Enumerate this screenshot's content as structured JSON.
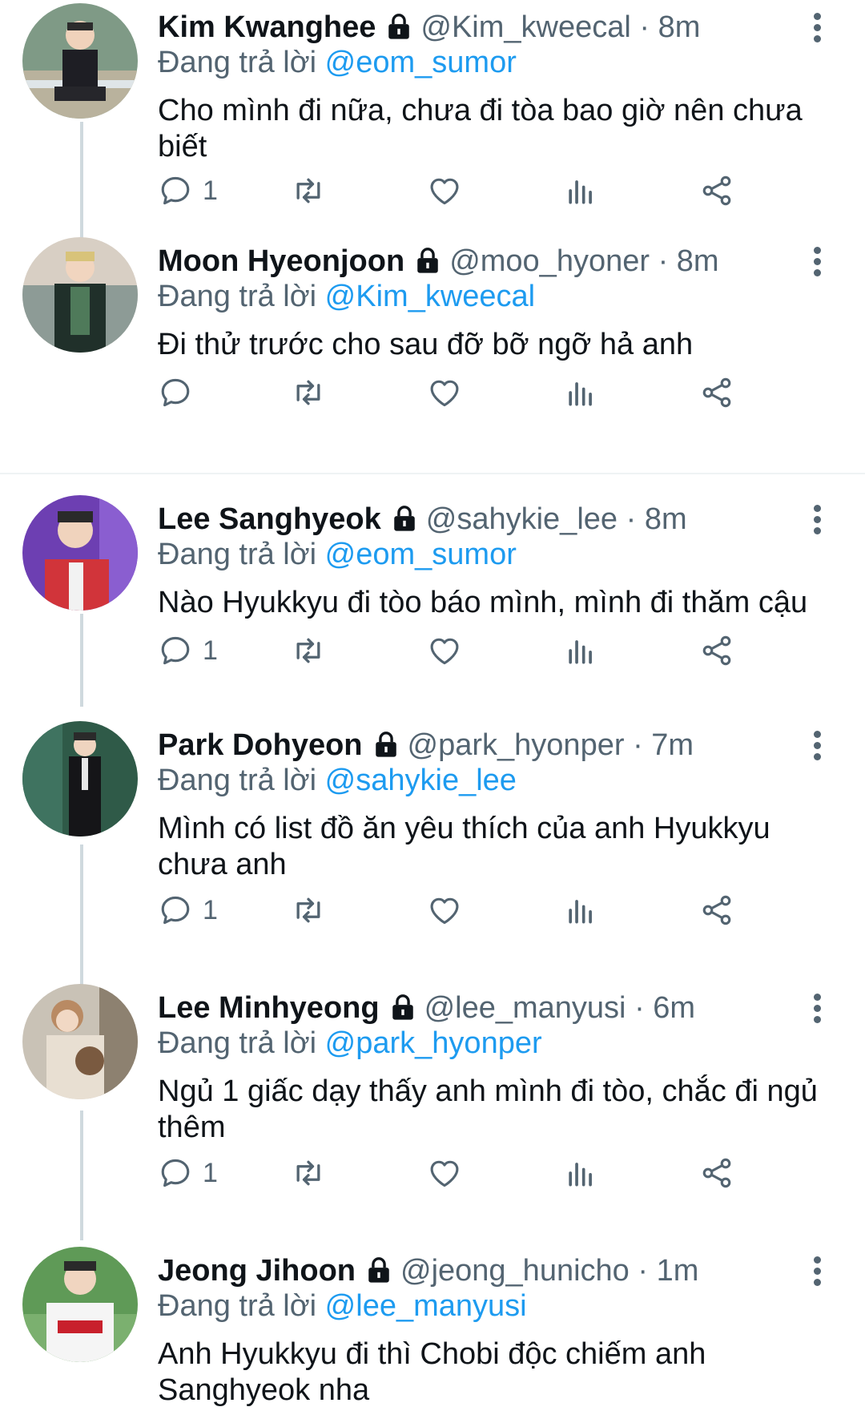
{
  "reply_prefix": "Đang trả lời",
  "colors": {
    "mention": "#1d9bf0",
    "secondary": "#536471",
    "text": "#0f1419"
  },
  "icons": [
    "reply-icon",
    "retweet-icon",
    "like-icon",
    "views-icon",
    "share-icon",
    "lock-icon",
    "more-icon"
  ],
  "tweets": [
    {
      "name": "Kim Kwanghee",
      "handle": "@Kim_kweecal",
      "dot": "·",
      "time": "8m",
      "reply_to": "@eom_sumor",
      "text": "Cho mình đi nữa, chưa đi tòa bao giờ nên chưa biết",
      "reply_count": "1"
    },
    {
      "name": "Moon Hyeonjoon",
      "handle": "@moo_hyoner",
      "dot": "·",
      "time": "8m",
      "reply_to": "@Kim_kweecal",
      "text": "Đi thử trước cho sau đỡ bỡ ngỡ hả anh",
      "reply_count": ""
    },
    {
      "name": "Lee Sanghyeok",
      "handle": "@sahykie_lee",
      "dot": "·",
      "time": "8m",
      "reply_to": "@eom_sumor",
      "text": "Nào Hyukkyu đi tòo báo mình, mình đi thăm cậu",
      "reply_count": "1"
    },
    {
      "name": "Park Dohyeon",
      "handle": "@park_hyonper",
      "dot": "·",
      "time": "7m",
      "reply_to": "@sahykie_lee",
      "text": "Mình có list đồ ăn yêu thích của anh Hyukkyu chưa anh",
      "reply_count": "1"
    },
    {
      "name": "Lee Minhyeong",
      "handle": "@lee_manyusi",
      "dot": "·",
      "time": "6m",
      "reply_to": "@park_hyonper",
      "text": "Ngủ 1 giấc dạy thấy anh mình đi tòo, chắc đi ngủ thêm",
      "reply_count": "1"
    },
    {
      "name": "Jeong Jihoon",
      "handle": "@jeong_hunicho",
      "dot": "·",
      "time": "1m",
      "reply_to": "@lee_manyusi",
      "text": "Anh Hyukkyu đi thì Chobi độc chiếm anh Sanghyeok nha",
      "reply_count": ""
    }
  ]
}
